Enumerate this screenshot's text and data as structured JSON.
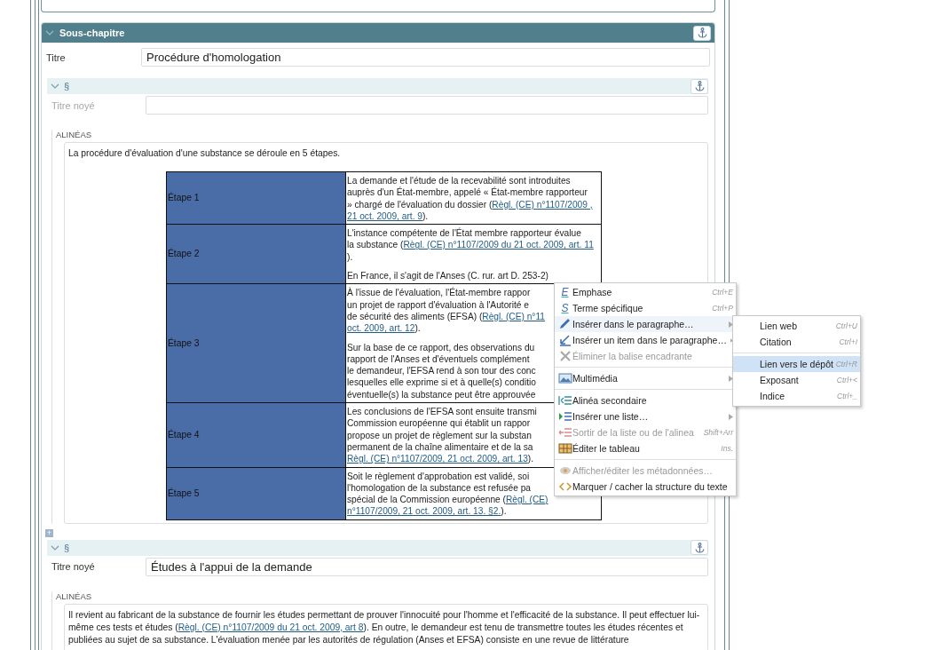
{
  "subchapter": {
    "heading": "Sous-chapitre",
    "expanded": true,
    "title_label": "Titre",
    "title_value": "Procédure d'homologation",
    "sections": [
      {
        "heading": "§",
        "expanded": true,
        "title_label": "Titre noyé",
        "paragraphs_label": "ALINÉAS",
        "intro": [
          {
            "text": "La procédure d'évaluation d'une substance se déroule en 5 étapes."
          }
        ],
        "table": {
          "rows": [
            {
              "step": "Étape 1",
              "paragraphs": [
                [
                  {
                    "text": "La demande et l'étude de la recevabilité sont introduites"
                  },
                  {
                    "text": "auprès d'un État-membre, appelé « État-membre rapporteur"
                  },
                  {
                    "text": "» chargé de l'évaluation du dossier (",
                    "link": "Règl. (CE) n°1107/2009 ,"
                  },
                  {
                    "link": "21 oct. 2009, art. 9",
                    "tail": ")."
                  }
                ]
              ]
            },
            {
              "step": "Étape 2",
              "paragraphs": [
                [
                  {
                    "text": "L'instance compétente de l'État membre rapporteur évalue"
                  },
                  {
                    "text": "la substance (",
                    "link": "Règl. (CE) n°1107/2009 du 21 oct. 2009, art. 11"
                  },
                  {
                    "text": ")."
                  }
                ],
                [
                  {
                    "text": "En France, il s'agit de l'Anses (C. rur. art D. 253-2)"
                  }
                ]
              ]
            },
            {
              "step": "Étape 3",
              "paragraphs": [
                [
                  {
                    "text": "À l'issue de l'évaluation, l'État-membre rappor"
                  },
                  {
                    "text": "un projet de rapport d'évaluation à l'Autorité e"
                  },
                  {
                    "text": "de sécurité des aliments (EFSA) (",
                    "link": "Règl. (CE) n°11"
                  },
                  {
                    "link": "oct. 2009, art. 12",
                    "tail": ")."
                  }
                ],
                [
                  {
                    "text": "Sur la base de ce rapport, des observations du"
                  },
                  {
                    "text": "rapport de l'Anses et d'éventuels complément"
                  },
                  {
                    "text": "le demandeur, l'EFSA rend à son tour des conc"
                  },
                  {
                    "text": "lesquelles elle exprime si et à quelle(s) conditio"
                  },
                  {
                    "text": "éventuelle(s) la substance peut être approuvée"
                  }
                ]
              ]
            },
            {
              "step": "Étape 4",
              "paragraphs": [
                [
                  {
                    "text": "Les conclusions de l'EFSA sont ensuite transmi"
                  },
                  {
                    "text": "Commission européenne qui établit un rappor"
                  },
                  {
                    "text": "propose un projet de règlement sur la substan"
                  },
                  {
                    "text": "permanent de la chaîne alimentaire et de la sa"
                  },
                  {
                    "link": "Règl. (CE) n°1107/2009, 21 oct. 2009, art. 13",
                    "tail": ")."
                  }
                ]
              ]
            },
            {
              "step": "Étape 5",
              "paragraphs": [
                [
                  {
                    "text": "Soit le règlement d'approbation est validé, soi"
                  },
                  {
                    "text": "l'homologation de la substance est refusée pa"
                  },
                  {
                    "text": "spécial de la Commission européenne (",
                    "link": "Règl. (CE)"
                  },
                  {
                    "link": "n°1107/2009, 21 oct. 2009, art. 13. §2.",
                    "tail": ")."
                  }
                ]
              ]
            }
          ]
        }
      },
      {
        "heading": "§",
        "expanded": true,
        "title_label": "Titre noyé",
        "title_value": "Études à l'appui de la demande",
        "paragraphs_label": "ALINÉAS",
        "intro": [
          {
            "text": "Il revient au fabricant de la substance de fournir les études permettant de prouver l'innocuité pour l'homme et l'efficacité de la substance. Il peut effectuer lui-même ces tests et études (",
            "link": "Règl. (CE) n°1107/2009 du 21 oct. 2009, art 8",
            "tail": "). En outre, le demandeur est tenu de transmettre toutes les études récentes et publiées au sujet de sa substance. L'évaluation menée par les autorités de régulation (Anses et EFSA) consiste en une revue de littérature"
          }
        ]
      }
    ]
  },
  "add_button": "+",
  "context_menu": {
    "items": [
      {
        "kind": "item",
        "glyph": "E",
        "label": "Emphase",
        "shortcut": "Ctrl+E",
        "submenu": false,
        "disabled": false,
        "selected": false
      },
      {
        "kind": "item",
        "glyph": "S",
        "label": "Terme spécifique",
        "shortcut": "Ctrl+P",
        "submenu": false,
        "disabled": false,
        "selected": false
      },
      {
        "kind": "item",
        "label": "Insérer dans le paragraphe…",
        "submenu": true,
        "disabled": false,
        "selected": true
      },
      {
        "kind": "item",
        "label": "Insérer un item dans le paragraphe…",
        "submenu": true,
        "disabled": false,
        "selected": false
      },
      {
        "kind": "item",
        "label": "Éliminer la balise encadrante",
        "submenu": false,
        "disabled": true,
        "selected": false
      },
      {
        "kind": "separator"
      },
      {
        "kind": "item",
        "label": "Multimédia",
        "submenu": true,
        "disabled": false,
        "selected": false
      },
      {
        "kind": "separator"
      },
      {
        "kind": "item",
        "label": "Alinéa secondaire",
        "submenu": false,
        "disabled": false,
        "selected": false
      },
      {
        "kind": "item",
        "label": "Insérer une liste…",
        "submenu": true,
        "disabled": false,
        "selected": false
      },
      {
        "kind": "item",
        "label": "Sortir de la liste ou de l'alinea",
        "shortcut": "Shift+Arr",
        "submenu": false,
        "disabled": true,
        "selected": false
      },
      {
        "kind": "item",
        "label": "Éditer le tableau",
        "shortcut": "Ins.",
        "submenu": false,
        "disabled": false,
        "selected": false
      },
      {
        "kind": "separator"
      },
      {
        "kind": "item",
        "label": "Afficher/éditer les métadonnées…",
        "submenu": false,
        "disabled": true,
        "selected": false
      },
      {
        "kind": "item",
        "label": "Marquer / cacher la structure du texte",
        "submenu": false,
        "disabled": false,
        "selected": false
      }
    ]
  },
  "submenu": {
    "items": [
      {
        "kind": "item",
        "label": "Lien web",
        "shortcut": "Ctrl+U",
        "selected": false
      },
      {
        "kind": "item",
        "label": "Citation",
        "shortcut": "Ctrl+I",
        "selected": false
      },
      {
        "kind": "separator"
      },
      {
        "kind": "item",
        "label": "Lien vers le dépôt",
        "shortcut": "Ctrl+R",
        "selected": true
      },
      {
        "kind": "item",
        "label": "Exposant",
        "shortcut": "Ctrl+<",
        "selected": false
      },
      {
        "kind": "item",
        "label": "Indice",
        "shortcut": "Ctrl+_",
        "selected": false
      }
    ]
  }
}
